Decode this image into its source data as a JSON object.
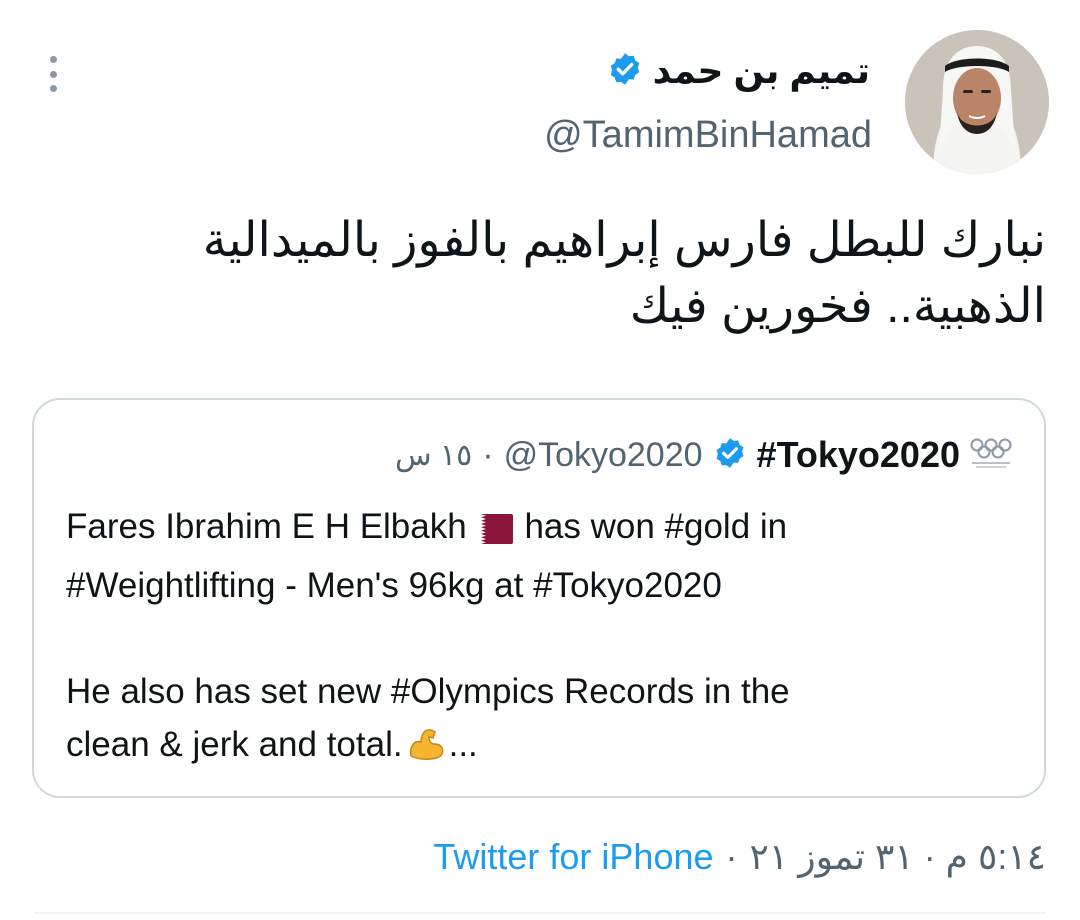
{
  "author": {
    "name": "تميم بن حمد",
    "handle": "@TamimBinHamad",
    "verified_icon": "verified-badge-icon"
  },
  "tweet": {
    "lines": [
      "نبارك للبطل فارس إبراهيم بالفوز بالميدالية",
      "الذهبية.. فخورين فيك"
    ]
  },
  "quoted_tweet": {
    "logo_icon": "olympic-paralympic-logo-icon",
    "name": "#Tokyo2020",
    "handle": "@Tokyo2020",
    "separator": "·",
    "time": "١٥ س",
    "body": {
      "line1_before_flag": "Fares Ibrahim E H Elbakh",
      "line1_after_flag": " has won #gold in",
      "line2": "#Weightlifting - Men's 96kg at #Tokyo2020",
      "line3": "He also has set new #Olympics Records in the",
      "line4_before_emoji": "clean & jerk and total.",
      "line4_after_emoji": "..."
    },
    "flag_icon": "qatar-flag-icon",
    "emoji_icon": "flexed-biceps-icon"
  },
  "footer": {
    "timestamp": "٥:١٤ م · ٣١ تموز ٢١",
    "separator": "·",
    "source": "Twitter for iPhone"
  },
  "colors": {
    "link_blue": "#1d9bf0",
    "secondary_text": "#536471",
    "border": "#cfd9de"
  }
}
